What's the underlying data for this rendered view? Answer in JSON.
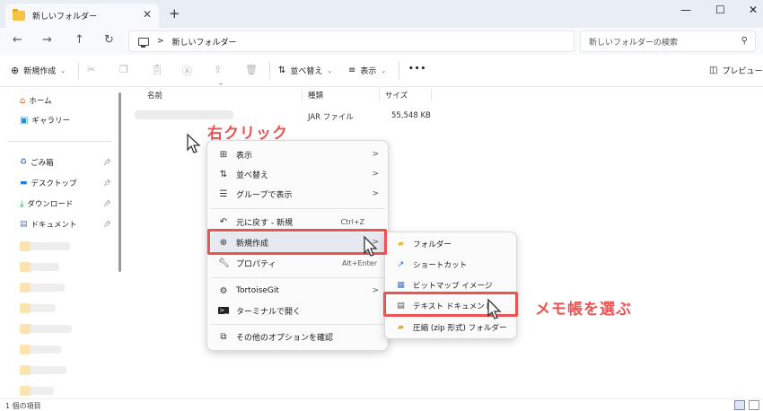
{
  "window": {
    "tab_title": "新しいフォルダー",
    "tab_close": "✕",
    "new_tab": "+",
    "minimize": "—",
    "maximize": "☐",
    "close": "✕"
  },
  "address": {
    "path": "新しいフォルダー",
    "separator": ">",
    "search_placeholder": "新しいフォルダーの検索"
  },
  "toolbar": {
    "new_label": "新規作成",
    "sort_label": "並べ替え",
    "view_label": "表示",
    "more_label": "•••",
    "preview_label": "プレビュー"
  },
  "nav": {
    "home": "ホーム",
    "gallery": "ギャラリー",
    "quick": [
      "ごみ箱",
      "デスクトップ",
      "ダウンロード",
      "ドキュメント"
    ]
  },
  "list": {
    "col_name": "名前",
    "col_type": "種類",
    "col_size": "サイズ",
    "row_type": "JAR ファイル",
    "row_size": "55,548 KB"
  },
  "status": {
    "count": "1 個の項目"
  },
  "context_menu": {
    "items": [
      {
        "label": "表示",
        "arrow": ">"
      },
      {
        "label": "並べ替え",
        "arrow": ">"
      },
      {
        "label": "グループで表示",
        "arrow": ">"
      },
      {
        "label": "元に戻す - 新規",
        "shortcut": "Ctrl+Z"
      },
      {
        "label": "新規作成",
        "arrow": ">"
      },
      {
        "label": "プロパティ",
        "shortcut": "Alt+Enter"
      },
      {
        "label": "TortoiseGit",
        "arrow": ">"
      },
      {
        "label": "ターミナルで開く"
      },
      {
        "label": "その他のオプションを確認"
      }
    ]
  },
  "submenu": {
    "items": [
      {
        "label": "フォルダー"
      },
      {
        "label": "ショートカット"
      },
      {
        "label": "ビットマップ イメージ"
      },
      {
        "label": "テキスト ドキュメント"
      },
      {
        "label": "圧縮 (zip 形式) フォルダー"
      }
    ]
  },
  "annotations": {
    "right_click": "右クリック",
    "choose_notepad": "メモ帳を選ぶ",
    "color": "#ee5353"
  }
}
